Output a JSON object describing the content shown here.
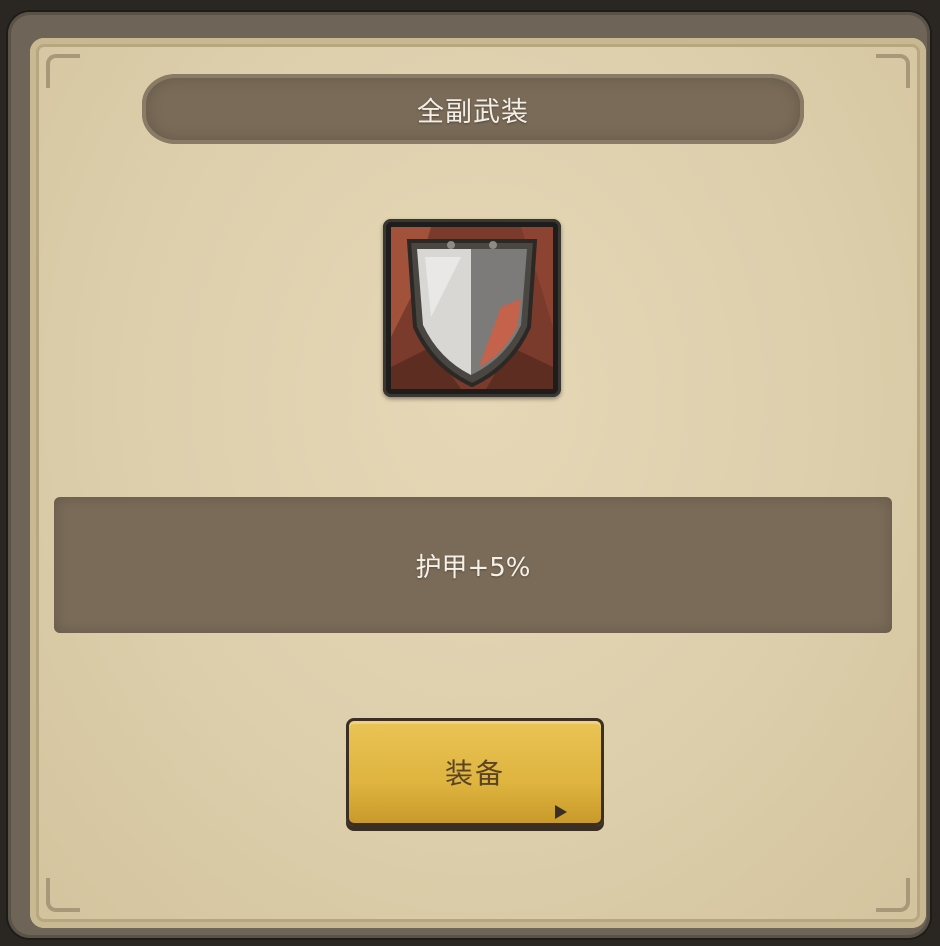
{
  "dialog": {
    "title": "全副武装",
    "item_icon": "shield-icon",
    "stat_text": "护甲+5%",
    "equip_button_label": "装备"
  },
  "colors": {
    "banner": "#7a6b58",
    "parchment": "#e0d2af",
    "button": "#dfb43f",
    "button_text": "#5a4424"
  }
}
